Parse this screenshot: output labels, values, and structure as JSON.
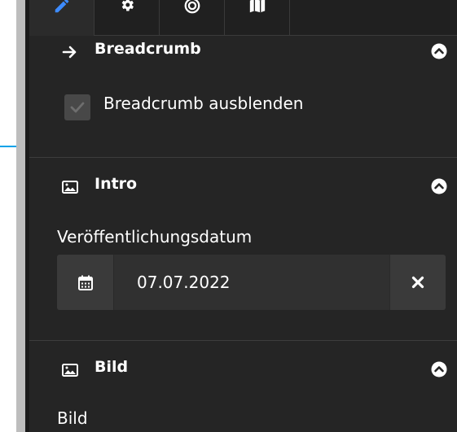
{
  "tabs": [
    {
      "icon": "pencil-icon",
      "active": true
    },
    {
      "icon": "gear-icon",
      "active": false
    },
    {
      "icon": "target-icon",
      "active": false
    },
    {
      "icon": "map-icon",
      "active": false
    }
  ],
  "sections": {
    "breadcrumb": {
      "title": "Breadcrumb",
      "icon": "arrow-right-icon",
      "checkbox_label": "Breadcrumb ausblenden",
      "checkbox_checked": true
    },
    "intro": {
      "title": "Intro",
      "icon": "image-icon",
      "date_label": "Veröffentlichungsdatum",
      "date_value": "07.07.2022"
    },
    "bild": {
      "title": "Bild",
      "icon": "image-icon",
      "field_label": "Bild"
    }
  },
  "colors": {
    "panel_bg": "#252525",
    "accent": "#00a2e8"
  }
}
